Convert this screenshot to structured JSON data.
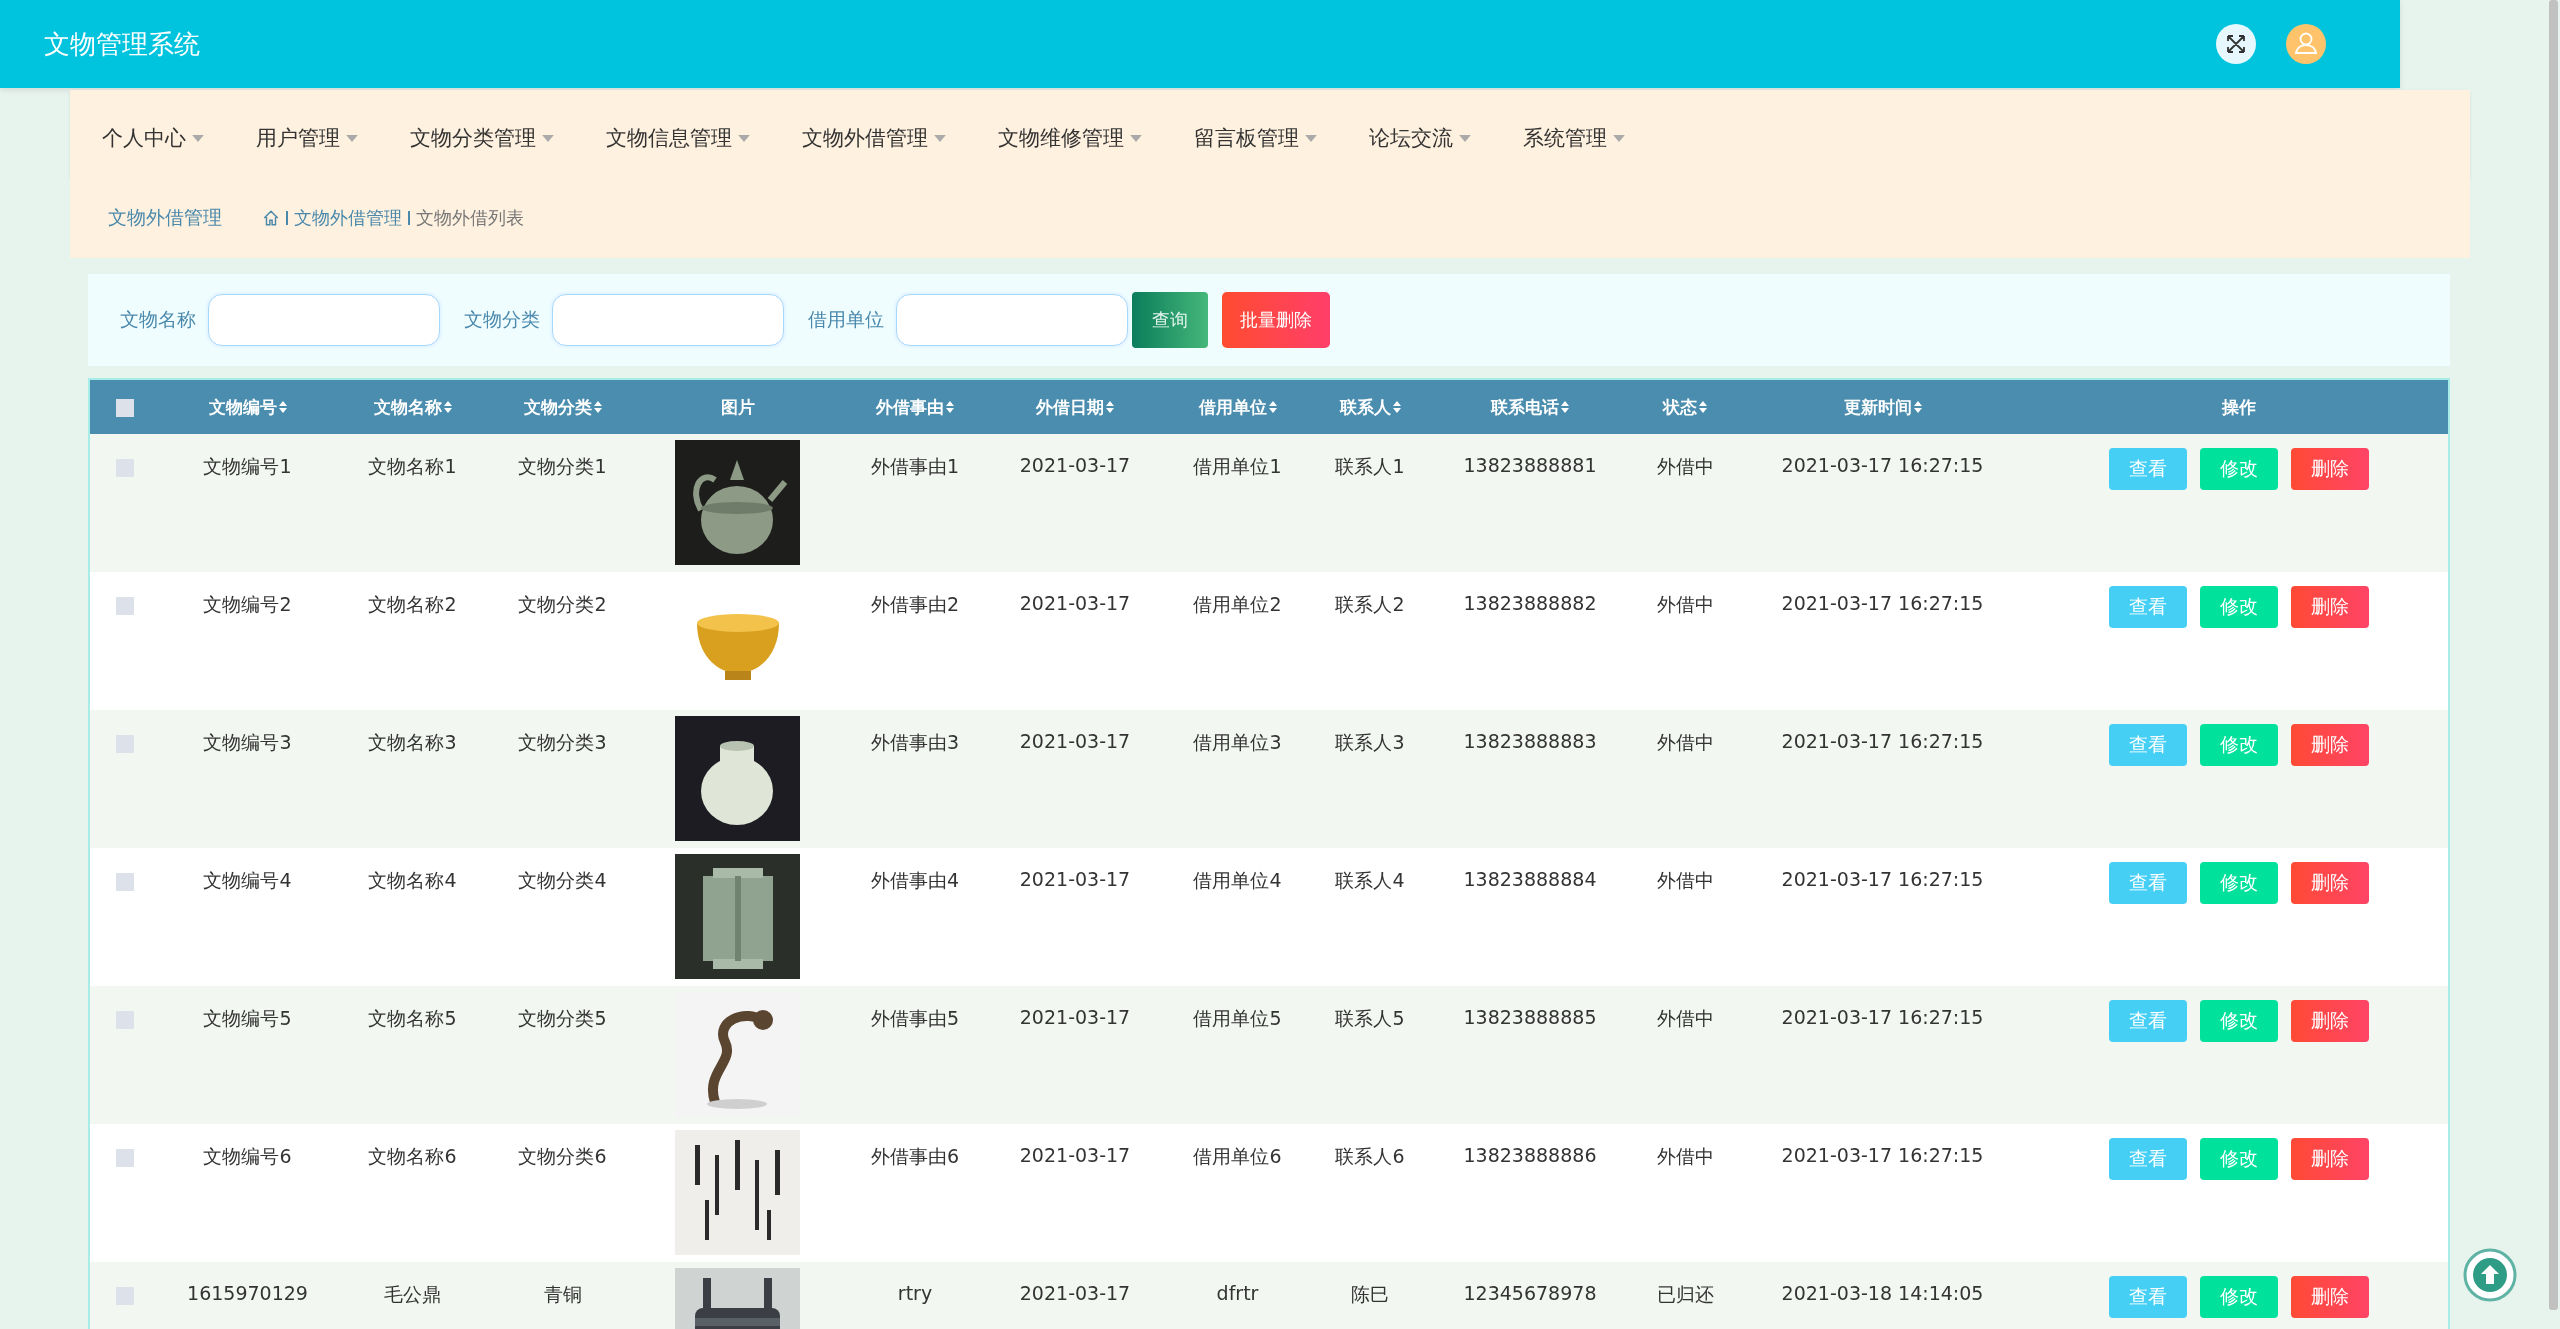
{
  "header": {
    "title": "文物管理系统"
  },
  "nav": [
    {
      "label": "个人中心"
    },
    {
      "label": "用户管理"
    },
    {
      "label": "文物分类管理"
    },
    {
      "label": "文物信息管理"
    },
    {
      "label": "文物外借管理"
    },
    {
      "label": "文物维修管理"
    },
    {
      "label": "留言板管理"
    },
    {
      "label": "论坛交流"
    },
    {
      "label": "系统管理"
    }
  ],
  "breadcrumb": {
    "section": "文物外借管理",
    "path": [
      "文物外借管理",
      "文物外借列表"
    ]
  },
  "search": {
    "fields": [
      {
        "label": "文物名称"
      },
      {
        "label": "文物分类"
      },
      {
        "label": "借用单位"
      }
    ],
    "query_button": "查询",
    "batch_delete_button": "批量删除"
  },
  "table": {
    "select_all": {
      "checked": false
    },
    "columns": [
      {
        "label": "文物编号",
        "sortable": true
      },
      {
        "label": "文物名称",
        "sortable": true
      },
      {
        "label": "文物分类",
        "sortable": true
      },
      {
        "label": "图片",
        "sortable": false
      },
      {
        "label": "外借事由",
        "sortable": true
      },
      {
        "label": "外借日期",
        "sortable": true
      },
      {
        "label": "借用单位",
        "sortable": true
      },
      {
        "label": "联系人",
        "sortable": true
      },
      {
        "label": "联系电话",
        "sortable": true
      },
      {
        "label": "状态",
        "sortable": true
      },
      {
        "label": "更新时间",
        "sortable": true
      },
      {
        "label": "操作",
        "sortable": false
      }
    ],
    "rows": [
      {
        "checked": false,
        "cells": [
          "文物编号1",
          "文物名称1",
          "文物分类1",
          {
            "kind": "picture"
          },
          "外借事由1",
          "2021-03-17",
          "借用单位1",
          "联系人1",
          "13823888881",
          "外借中",
          "2021-03-17 16:27:15"
        ],
        "actions": [
          {
            "label": "查看",
            "kind": "view"
          },
          {
            "label": "修改",
            "kind": "edit"
          },
          {
            "label": "删除",
            "kind": "delete"
          }
        ]
      },
      {
        "checked": false,
        "cells": [
          "文物编号2",
          "文物名称2",
          "文物分类2",
          {
            "kind": "picture"
          },
          "外借事由2",
          "2021-03-17",
          "借用单位2",
          "联系人2",
          "13823888882",
          "外借中",
          "2021-03-17 16:27:15"
        ],
        "actions": [
          {
            "label": "查看",
            "kind": "view"
          },
          {
            "label": "修改",
            "kind": "edit"
          },
          {
            "label": "删除",
            "kind": "delete"
          }
        ]
      },
      {
        "checked": false,
        "cells": [
          "文物编号3",
          "文物名称3",
          "文物分类3",
          {
            "kind": "picture"
          },
          "外借事由3",
          "2021-03-17",
          "借用单位3",
          "联系人3",
          "13823888883",
          "外借中",
          "2021-03-17 16:27:15"
        ],
        "actions": [
          {
            "label": "查看",
            "kind": "view"
          },
          {
            "label": "修改",
            "kind": "edit"
          },
          {
            "label": "删除",
            "kind": "delete"
          }
        ]
      },
      {
        "checked": false,
        "cells": [
          "文物编号4",
          "文物名称4",
          "文物分类4",
          {
            "kind": "picture"
          },
          "外借事由4",
          "2021-03-17",
          "借用单位4",
          "联系人4",
          "13823888884",
          "外借中",
          "2021-03-17 16:27:15"
        ],
        "actions": [
          {
            "label": "查看",
            "kind": "view"
          },
          {
            "label": "修改",
            "kind": "edit"
          },
          {
            "label": "删除",
            "kind": "delete"
          }
        ]
      },
      {
        "checked": false,
        "cells": [
          "文物编号5",
          "文物名称5",
          "文物分类5",
          {
            "kind": "picture"
          },
          "外借事由5",
          "2021-03-17",
          "借用单位5",
          "联系人5",
          "13823888885",
          "外借中",
          "2021-03-17 16:27:15"
        ],
        "actions": [
          {
            "label": "查看",
            "kind": "view"
          },
          {
            "label": "修改",
            "kind": "edit"
          },
          {
            "label": "删除",
            "kind": "delete"
          }
        ]
      },
      {
        "checked": false,
        "cells": [
          "文物编号6",
          "文物名称6",
          "文物分类6",
          {
            "kind": "picture"
          },
          "外借事由6",
          "2021-03-17",
          "借用单位6",
          "联系人6",
          "13823888886",
          "外借中",
          "2021-03-17 16:27:15"
        ],
        "actions": [
          {
            "label": "查看",
            "kind": "view"
          },
          {
            "label": "修改",
            "kind": "edit"
          },
          {
            "label": "删除",
            "kind": "delete"
          }
        ]
      },
      {
        "checked": false,
        "cells": [
          "1615970129",
          "毛公鼎",
          "青铜",
          {
            "kind": "picture"
          },
          "rtry",
          "2021-03-17",
          "dfrtr",
          "陈巳",
          "12345678978",
          "已归还",
          "2021-03-18 14:14:05"
        ],
        "actions": [
          {
            "label": "查看",
            "kind": "view"
          },
          {
            "label": "修改",
            "kind": "edit"
          },
          {
            "label": "删除",
            "kind": "delete"
          }
        ]
      }
    ]
  }
}
